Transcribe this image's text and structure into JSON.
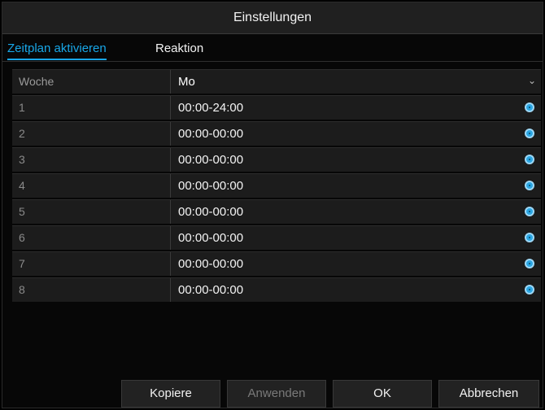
{
  "window": {
    "title": "Einstellungen"
  },
  "tabs": [
    {
      "label": "Zeitplan aktivieren",
      "active": true
    },
    {
      "label": "Reaktion",
      "active": false
    }
  ],
  "week_row": {
    "label": "Woche",
    "value": "Mo"
  },
  "schedule": [
    {
      "num": "1",
      "time": "00:00-24:00"
    },
    {
      "num": "2",
      "time": "00:00-00:00"
    },
    {
      "num": "3",
      "time": "00:00-00:00"
    },
    {
      "num": "4",
      "time": "00:00-00:00"
    },
    {
      "num": "5",
      "time": "00:00-00:00"
    },
    {
      "num": "6",
      "time": "00:00-00:00"
    },
    {
      "num": "7",
      "time": "00:00-00:00"
    },
    {
      "num": "8",
      "time": "00:00-00:00"
    }
  ],
  "buttons": {
    "copy": "Kopiere",
    "apply": "Anwenden",
    "ok": "OK",
    "cancel": "Abbrechen"
  },
  "colors": {
    "accent": "#18a7e8",
    "clock_icon": "#2aa6e3"
  },
  "icons": {
    "row_action": "clock-icon",
    "dropdown": "chevron-down-icon"
  }
}
